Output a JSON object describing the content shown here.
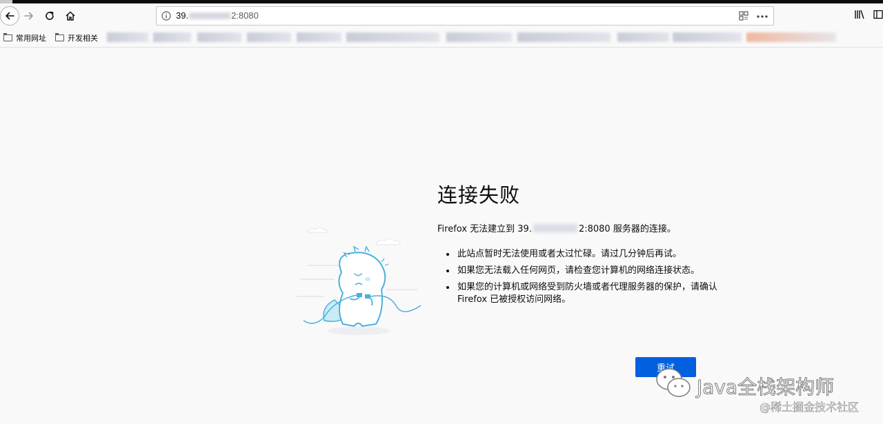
{
  "toolbar": {
    "url_prefix": "39.",
    "url_suffix": "2:8080"
  },
  "bookmarks": {
    "items": [
      {
        "label": "常用网址"
      },
      {
        "label": "开发相关"
      }
    ]
  },
  "error_page": {
    "title": "连接失败",
    "desc_prefix": "Firefox 无法建立到 39.",
    "desc_suffix": "2:8080 服务器的连接。",
    "reasons": [
      "此站点暂时无法使用或者太过忙碌。请过几分钟后再试。",
      "如果您无法载入任何网页，请检查您计算机的网络连接状态。",
      "如果您的计算机或网络受到防火墙或者代理服务器的保护，请确认 Firefox 已被授权访问网络。"
    ],
    "retry_label": "重试"
  },
  "watermark": {
    "main": "Java全栈架构师",
    "sub": "@稀土掘金技术社区"
  },
  "colors": {
    "accent": "#0060df",
    "page_bg": "#f9f9fa"
  }
}
